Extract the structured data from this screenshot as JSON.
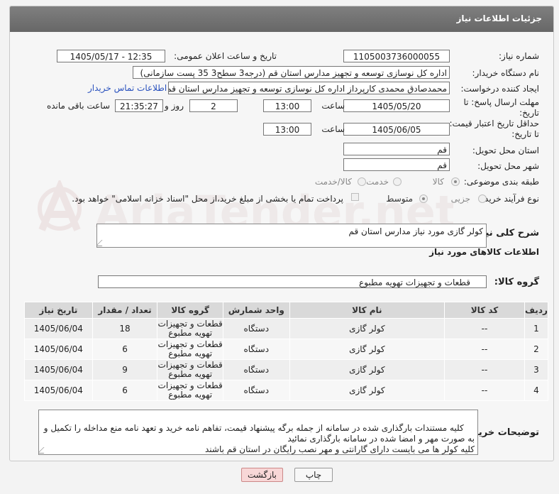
{
  "header": {
    "title": "جزئیات اطلاعات نیاز"
  },
  "form": {
    "need_number": {
      "label": "شماره نیاز:",
      "value": "1105003736000055"
    },
    "announce_datetime": {
      "label": "تاریخ و ساعت اعلان عمومی:",
      "value": "1405/05/17 - 12:35"
    },
    "buyer_org": {
      "label": "نام دستگاه خریدار:",
      "value": "اداره کل نوسازی   توسعه و تجهیز مدارس استان قم (درجه3 سطح3  35 پست سازمانی)"
    },
    "requester": {
      "label": "ایجاد کننده درخواست:",
      "value": "محمدصادق محمدی کارپرداز  اداره کل نوسازی   توسعه و تجهیز مدارس استان قم"
    },
    "contact_link": "اطلاعات تماس خریدار",
    "reply_deadline": {
      "label_line1": "مهلت ارسال پاسخ: تا",
      "label_line2": "تاریخ:",
      "date": "1405/05/20",
      "time_label": "ساعت",
      "time": "13:00",
      "days": "2",
      "days_label": "روز و",
      "remaining": "21:35:27",
      "remaining_label": "ساعت باقی مانده"
    },
    "price_validity": {
      "label_line1": "حداقل تاریخ اعتبار قیمت:",
      "label_line2": "تا تاریخ:",
      "date": "1405/06/05",
      "time_label": "ساعت",
      "time": "13:00"
    },
    "delivery_province": {
      "label": "استان محل تحویل:",
      "value": "قم"
    },
    "delivery_city": {
      "label": "شهر محل تحویل:",
      "value": "قم"
    },
    "category": {
      "label": "طبقه بندی موضوعی:",
      "options": [
        "کالا",
        "خدمت",
        "کالا/خدمت"
      ],
      "selected": "کالا"
    },
    "purchase_type": {
      "label": "نوع فرآیند خرید :",
      "options": [
        "جزیی",
        "متوسط"
      ],
      "selected": "متوسط",
      "treasury_note": "پرداخت تمام یا بخشی از مبلغ خرید،از محل \"اسناد خزانه اسلامی\" خواهد بود."
    },
    "need_summary": {
      "label": "شرح کلی نیاز:",
      "value": "کولر گازی مورد نیاز مدارس استان قم"
    }
  },
  "goods_section": {
    "title": "اطلاعات کالاهای مورد نیاز",
    "group_label": "گروه کالا:",
    "group_value": "قطعات و تجهیزات تهویه مطبوع"
  },
  "table": {
    "headers": [
      "ردیف",
      "کد کالا",
      "نام کالا",
      "واحد شمارش",
      "گروه کالا",
      "تعداد / مقدار",
      "تاریخ نیاز"
    ],
    "rows": [
      [
        "1",
        "--",
        "کولر گازی",
        "دستگاه",
        "قطعات و تجهیزات تهویه مطبوع",
        "18",
        "1405/06/04"
      ],
      [
        "2",
        "--",
        "کولر گازی",
        "دستگاه",
        "قطعات و تجهیزات تهویه مطبوع",
        "6",
        "1405/06/04"
      ],
      [
        "3",
        "--",
        "کولر گازی",
        "دستگاه",
        "قطعات و تجهیزات تهویه مطبوع",
        "9",
        "1405/06/04"
      ],
      [
        "4",
        "--",
        "کولر گازی",
        "دستگاه",
        "قطعات و تجهیزات تهویه مطبوع",
        "6",
        "1405/06/04"
      ]
    ]
  },
  "buyer_notes": {
    "label": "توضیحات خریدار:",
    "text": "کلیه مستندات بارگذاری شده در سامانه از جمله برگه پیشنهاد قیمت، تفاهم نامه خرید و تعهد نامه منع مداخله را تکمیل و به صورت مهر و امضا شده در سامانه بارگذاری نمائید\nکلیه کولر ها می بایست دارای گارانتی و مهر نصب رایگان در استان قم باشند"
  },
  "buttons": {
    "print": "چاپ",
    "back": "بازگشت"
  },
  "colors": {
    "header_bg": "#707070",
    "link": "#2a52be",
    "back_button_bg": "#f8d7d7",
    "table_header": "#d9d9d9"
  }
}
